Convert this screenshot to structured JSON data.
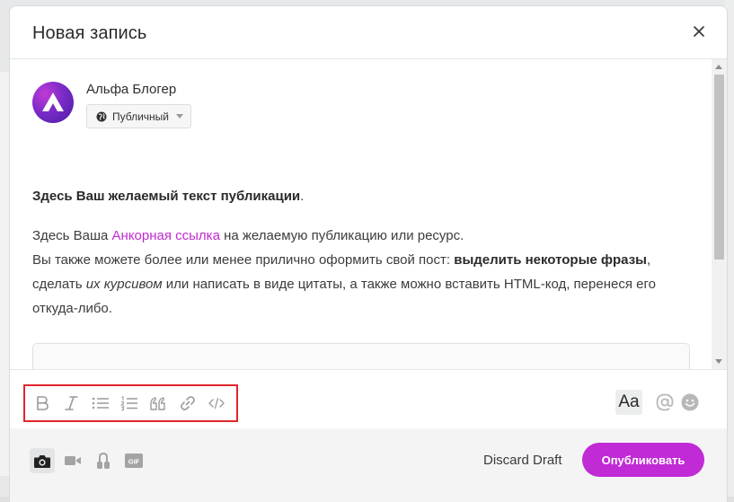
{
  "modal": {
    "title": "Новая запись"
  },
  "author": {
    "name": "Альфа Блогер",
    "privacy_label": "Публичный"
  },
  "post": {
    "heading_bold": "Здесь Ваш желаемый текст публикации",
    "heading_end": ".",
    "p2_start": "Здесь Ваша ",
    "p2_link": "Анкорная ссылка",
    "p2_end": " на желаемую публикацию или ресурс.",
    "p3_start": "Вы также можете более или менее прилично оформить свой пост: ",
    "p3_bold": "выделить некоторые фразы",
    "p3_mid": ", сделать ",
    "p3_italic": "их курсивом",
    "p3_end": " или написать в виде цитаты, а также можно вставить HTML-код, перенеся его откуда-либо."
  },
  "toolbar": {
    "format_icons": [
      "bold-icon",
      "italic-icon",
      "bullet-list-icon",
      "numbered-list-icon",
      "quote-icon",
      "link-icon",
      "code-icon"
    ],
    "text_style_label": "Aa",
    "right_icons": [
      "mention-icon",
      "emoji-icon"
    ]
  },
  "footer": {
    "media_icons": [
      "camera-icon",
      "video-icon",
      "audio-icon",
      "gif-icon"
    ],
    "gif_label": "GIF",
    "discard_label": "Discard Draft",
    "publish_label": "Опубликовать"
  },
  "colors": {
    "accent": "#c02bd6",
    "link": "#c12ad0",
    "highlight_border": "#e0262c"
  }
}
